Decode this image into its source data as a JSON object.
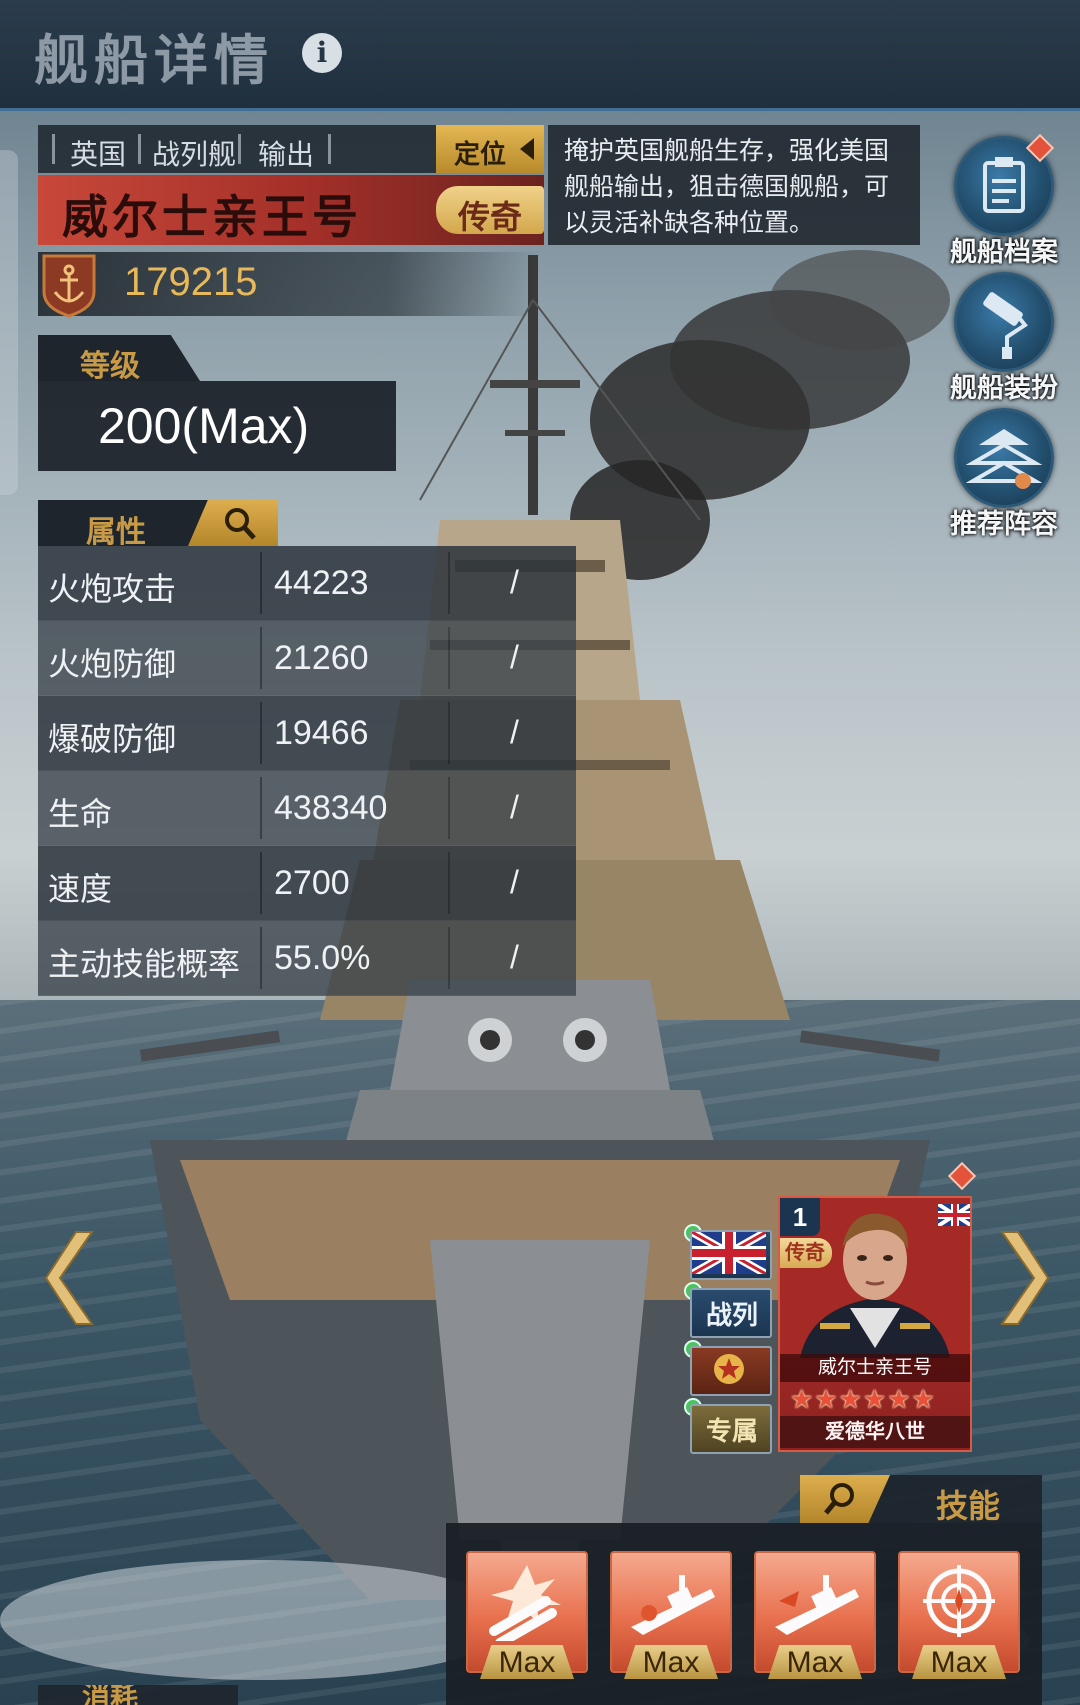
{
  "header": {
    "title": "舰船详情",
    "info_icon": "i"
  },
  "ship": {
    "tags": [
      "英国",
      "战列舰",
      "输出"
    ],
    "position_label": "定位",
    "description": "掩护英国舰船生存，强化美国舰船输出，狙击德国舰船，可以灵活补缺各种位置。",
    "name": "威尔士亲王号",
    "rarity": "传奇",
    "power": "179215"
  },
  "level": {
    "label": "等级",
    "value": "200(Max)"
  },
  "attributes": {
    "label": "属性",
    "rows": [
      {
        "name": "火炮攻击",
        "value": "44223",
        "extra": "/"
      },
      {
        "name": "火炮防御",
        "value": "21260",
        "extra": "/"
      },
      {
        "name": "爆破防御",
        "value": "19466",
        "extra": "/"
      },
      {
        "name": "生命",
        "value": "438340",
        "extra": "/"
      },
      {
        "name": "速度",
        "value": "2700",
        "extra": "/"
      },
      {
        "name": "主动技能概率",
        "value": "55.0%",
        "extra": "/"
      }
    ]
  },
  "side_buttons": [
    {
      "label": "舰船档案",
      "icon": "clipboard-icon"
    },
    {
      "label": "舰船装扮",
      "icon": "paint-roller-icon"
    },
    {
      "label": "推荐阵容",
      "icon": "fleet-formation-icon"
    }
  ],
  "captain": {
    "slot": "1",
    "rarity": "传奇",
    "ship_name": "威尔士亲王号",
    "name": "爱德华八世",
    "stars": 6,
    "icon_buttons": [
      {
        "label": "",
        "icon": "uk-flag-icon"
      },
      {
        "label": "战列",
        "icon": "battleship-type-icon"
      },
      {
        "label": "",
        "icon": "rank-emblem-icon"
      },
      {
        "label": "专属",
        "icon": "exclusive-icon"
      }
    ]
  },
  "skills": {
    "label": "技能",
    "items": [
      {
        "icon": "cannon-barrage-icon",
        "level": "Max"
      },
      {
        "icon": "ship-support-icon",
        "level": "Max"
      },
      {
        "icon": "ship-attack-icon",
        "level": "Max"
      },
      {
        "icon": "crosshair-icon",
        "level": "Max"
      }
    ]
  },
  "consume_label": "消耗",
  "colors": {
    "accent_gold": "#c99a45",
    "rarity_red": "#b7332e",
    "header_blue": "#1f2f3e"
  }
}
